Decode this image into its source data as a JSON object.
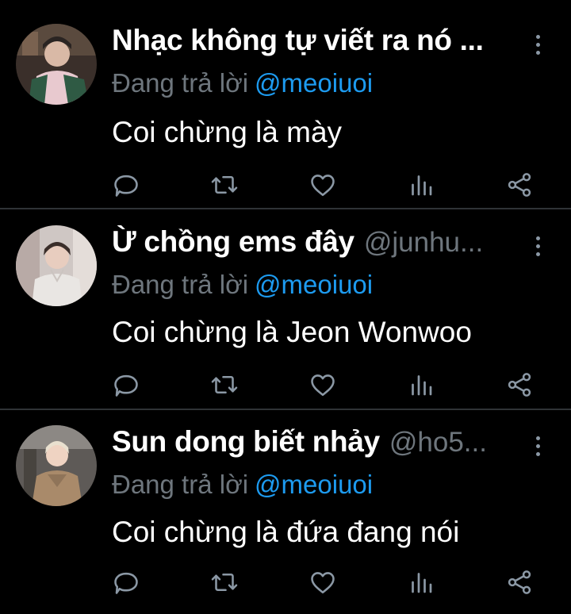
{
  "colors": {
    "background": "#000000",
    "name": "#ffffff",
    "muted": "#6e767d",
    "mention": "#1d9bf0",
    "divider": "#2f3336",
    "icon": "#8b98a5"
  },
  "tweets": [
    {
      "display_name": "Nhạc không tự viết ra nó ...",
      "handle": "",
      "reply_prefix": "Đang trả lời",
      "reply_to": "@meoiuoi",
      "text": "Coi chừng là mày",
      "icons": [
        "reply-icon",
        "retweet-icon",
        "like-icon",
        "stats-icon",
        "share-icon"
      ]
    },
    {
      "display_name": "Ừ chồng ems đây",
      "handle": "@junhu...",
      "reply_prefix": "Đang trả lời",
      "reply_to": "@meoiuoi",
      "text": "Coi chừng là Jeon Wonwoo",
      "icons": [
        "reply-icon",
        "retweet-icon",
        "like-icon",
        "stats-icon",
        "share-icon"
      ]
    },
    {
      "display_name": "Sun dong biết nhảy",
      "handle": "@ho5...",
      "reply_prefix": "Đang trả lời",
      "reply_to": "@meoiuoi",
      "text": "Coi chừng là đứa đang nói",
      "icons": [
        "reply-icon",
        "retweet-icon",
        "like-icon",
        "stats-icon",
        "share-icon"
      ]
    }
  ]
}
